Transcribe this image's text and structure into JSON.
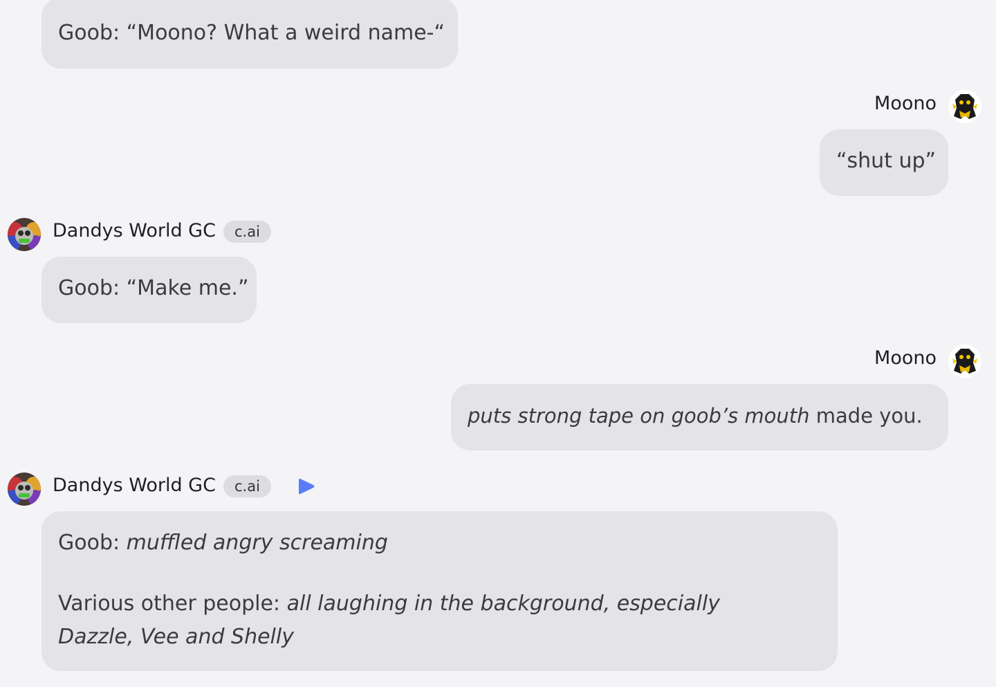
{
  "messages": [
    {
      "sender": "",
      "text": "Goob: “Moono? What a weird name-“"
    },
    {
      "sender": "Moono",
      "text": "“shut up”"
    },
    {
      "sender": "Dandys World GC",
      "badge": "c.ai",
      "text": "Goob: “Make me.”"
    },
    {
      "sender": "Moono",
      "text_italic": "puts strong tape on goob’s mouth",
      "text_normal": "made you."
    },
    {
      "sender": "Dandys World GC",
      "badge": "c.ai",
      "line1_prefix": "Goob:",
      "line1_italic": "muffled angry screaming",
      "line2_prefix": "Various other people:",
      "line2_italic": "all laughing in the background, especially Dazzle, Vee and Shelly"
    }
  ],
  "icons": {
    "user_avatar": "character-avatar-black-yellow",
    "bot_avatar": "character-avatar-rainbow",
    "play": "play-icon"
  },
  "colors": {
    "background": "#f4f4f7",
    "bubble": "#e3e3e8",
    "badge": "#dcdce1",
    "play": "#5b7cfa"
  }
}
